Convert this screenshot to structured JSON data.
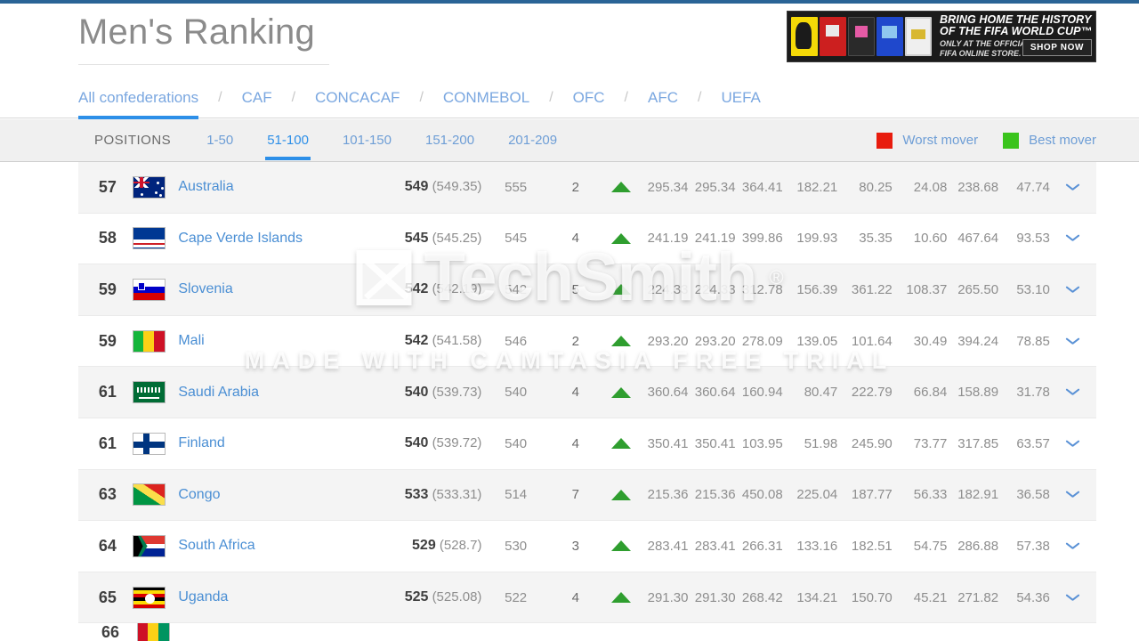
{
  "header": {
    "title": "Men's Ranking"
  },
  "ad": {
    "line1": "BRING HOME THE HISTORY",
    "line2": "OF THE FIFA WORLD CUP™",
    "line3": "ONLY AT THE OFFICIAL",
    "line4": "FIFA ONLINE STORE.",
    "cta": "SHOP NOW"
  },
  "confederations": {
    "separator": "/",
    "items": [
      {
        "label": "All confederations",
        "active": true
      },
      {
        "label": "CAF",
        "active": false
      },
      {
        "label": "CONCACAF",
        "active": false
      },
      {
        "label": "CONMEBOL",
        "active": false
      },
      {
        "label": "OFC",
        "active": false
      },
      {
        "label": "AFC",
        "active": false
      },
      {
        "label": "UEFA",
        "active": false
      }
    ]
  },
  "positions": {
    "label": "POSITIONS",
    "items": [
      {
        "label": "1-50",
        "active": false
      },
      {
        "label": "51-100",
        "active": true
      },
      {
        "label": "101-150",
        "active": false
      },
      {
        "label": "151-200",
        "active": false
      },
      {
        "label": "201-209",
        "active": false
      }
    ]
  },
  "legend": {
    "worst": {
      "label": "Worst mover",
      "color": "#e81c0e"
    },
    "best": {
      "label": "Best mover",
      "color": "#3ac41c"
    }
  },
  "colors": {
    "accent_blue": "#2d8fe8",
    "link_blue": "#4b8fd4",
    "up_arrow_green": "#2f9e2f"
  },
  "watermark": {
    "brand": "TechSmith",
    "registered": "®",
    "subtitle": "MADE WITH CAMTASIA FREE TRIAL"
  },
  "table": {
    "rows": [
      {
        "rank": "57",
        "country": "Australia",
        "flag": "au",
        "points": "549",
        "points_exact": "(549.35)",
        "previous": "555",
        "change": "2",
        "direction": "up",
        "cols": [
          "295.34",
          "295.34",
          "364.41",
          "182.21",
          "80.25",
          "24.08",
          "238.68",
          "47.74"
        ]
      },
      {
        "rank": "58",
        "country": "Cape Verde Islands",
        "flag": "cv",
        "points": "545",
        "points_exact": "(545.25)",
        "previous": "545",
        "change": "4",
        "direction": "up",
        "cols": [
          "241.19",
          "241.19",
          "399.86",
          "199.93",
          "35.35",
          "10.60",
          "467.64",
          "93.53"
        ]
      },
      {
        "rank": "59",
        "country": "Slovenia",
        "flag": "si",
        "points": "542",
        "points_exact": "(542.19)",
        "previous": "542",
        "change": "5",
        "direction": "up",
        "cols": [
          "224.33",
          "224.33",
          "312.78",
          "156.39",
          "361.22",
          "108.37",
          "265.50",
          "53.10"
        ]
      },
      {
        "rank": "59",
        "country": "Mali",
        "flag": "ml",
        "points": "542",
        "points_exact": "(541.58)",
        "previous": "546",
        "change": "2",
        "direction": "up",
        "cols": [
          "293.20",
          "293.20",
          "278.09",
          "139.05",
          "101.64",
          "30.49",
          "394.24",
          "78.85"
        ]
      },
      {
        "rank": "61",
        "country": "Saudi Arabia",
        "flag": "sa",
        "points": "540",
        "points_exact": "(539.73)",
        "previous": "540",
        "change": "4",
        "direction": "up",
        "cols": [
          "360.64",
          "360.64",
          "160.94",
          "80.47",
          "222.79",
          "66.84",
          "158.89",
          "31.78"
        ]
      },
      {
        "rank": "61",
        "country": "Finland",
        "flag": "fi",
        "points": "540",
        "points_exact": "(539.72)",
        "previous": "540",
        "change": "4",
        "direction": "up",
        "cols": [
          "350.41",
          "350.41",
          "103.95",
          "51.98",
          "245.90",
          "73.77",
          "317.85",
          "63.57"
        ]
      },
      {
        "rank": "63",
        "country": "Congo",
        "flag": "cg",
        "points": "533",
        "points_exact": "(533.31)",
        "previous": "514",
        "change": "7",
        "direction": "up",
        "cols": [
          "215.36",
          "215.36",
          "450.08",
          "225.04",
          "187.77",
          "56.33",
          "182.91",
          "36.58"
        ]
      },
      {
        "rank": "64",
        "country": "South Africa",
        "flag": "za",
        "points": "529",
        "points_exact": "(528.7)",
        "previous": "530",
        "change": "3",
        "direction": "up",
        "cols": [
          "283.41",
          "283.41",
          "266.31",
          "133.16",
          "182.51",
          "54.75",
          "286.88",
          "57.38"
        ]
      },
      {
        "rank": "65",
        "country": "Uganda",
        "flag": "ug",
        "points": "525",
        "points_exact": "(525.08)",
        "previous": "522",
        "change": "4",
        "direction": "up",
        "cols": [
          "291.30",
          "291.30",
          "268.42",
          "134.21",
          "150.70",
          "45.21",
          "271.82",
          "54.36"
        ]
      },
      {
        "rank": "66",
        "country": "",
        "flag": "gn",
        "points": "",
        "points_exact": "",
        "previous": "",
        "change": "",
        "direction": "up",
        "cols": [],
        "partial": true
      }
    ]
  }
}
